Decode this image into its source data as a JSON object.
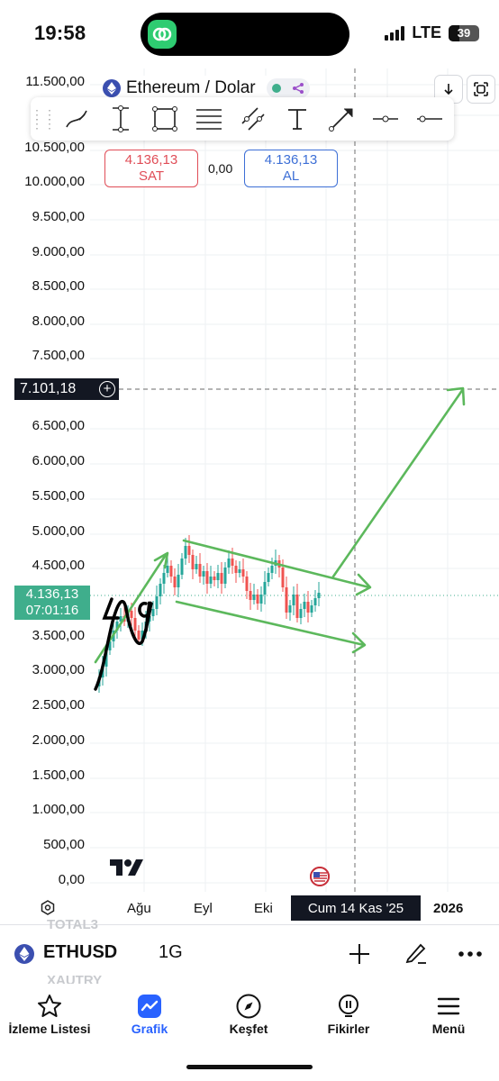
{
  "status_bar": {
    "time": "19:58",
    "network": "LTE",
    "battery": "39"
  },
  "chart": {
    "symbol_title": "Ethereum / Dolar",
    "y_axis_labels": [
      "11.500,00",
      "11",
      "10.500,00",
      "10.000,00",
      "9.500,00",
      "9.000,00",
      "8.500,00",
      "8.000,00",
      "7.500,00",
      "6.500,00",
      "6.000,00",
      "5.500,00",
      "5.000,00",
      "4.500,00",
      "3.500,00",
      "3.000,00",
      "2.500,00",
      "2.000,00",
      "1.500,00",
      "1.000,00",
      "500,00",
      "0,00"
    ],
    "x_axis_labels": [
      "Ağu",
      "Eyl",
      "Eki",
      "2026"
    ],
    "sell": {
      "price": "4.136,13",
      "label": "SAT"
    },
    "buy": {
      "price": "4.136,13",
      "label": "AL"
    },
    "spread": "0,00",
    "target_price": "7.101,18",
    "current_price": "4.136,13",
    "countdown": "07:01:16",
    "crosshair_date": "Cum 14 Kas '25",
    "annotation_text": "49",
    "colors": {
      "up": "#26a69a",
      "down": "#ef5350",
      "drawing": "#5cb85c",
      "sell": "#e04d57",
      "buy": "#3d6fd6",
      "price_tag": "#3fae8c"
    }
  },
  "ghost_list": {
    "above": "TOTAL3",
    "below": "XAUTRY"
  },
  "symbol_bar": {
    "code": "ETHUSD",
    "interval": "1G"
  },
  "nav": [
    {
      "label": "İzleme Listesi",
      "icon": "star-icon"
    },
    {
      "label": "Grafik",
      "icon": "chart-icon"
    },
    {
      "label": "Keşfet",
      "icon": "compass-icon"
    },
    {
      "label": "Fikirler",
      "icon": "lightbulb-icon"
    },
    {
      "label": "Menü",
      "icon": "menu-icon"
    }
  ]
}
